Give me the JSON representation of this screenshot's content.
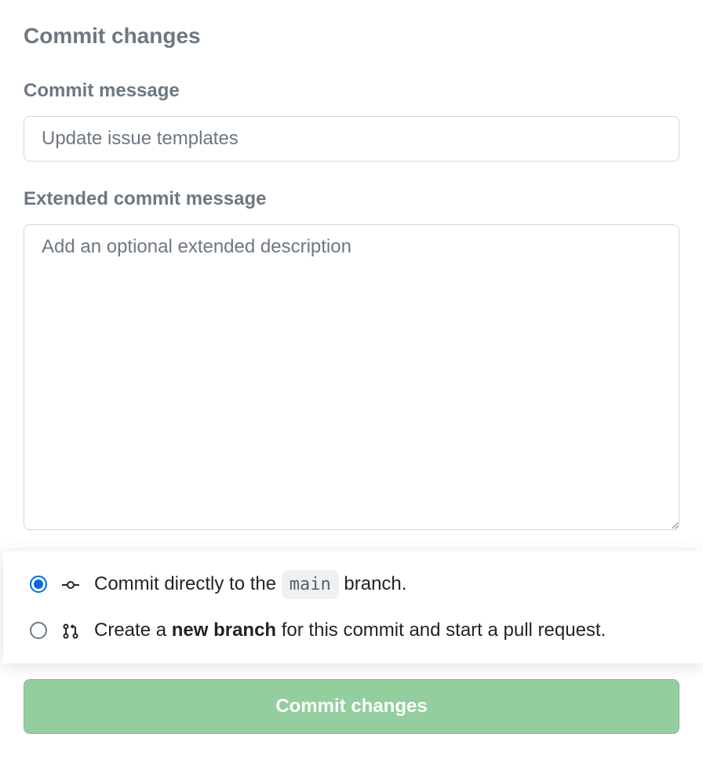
{
  "heading": "Commit changes",
  "commit_message": {
    "label": "Commit message",
    "value": "Update issue templates"
  },
  "extended_message": {
    "label": "Extended commit message",
    "placeholder": "Add an optional extended description"
  },
  "branch_options": {
    "direct": {
      "prefix": "Commit directly to the ",
      "branch": "main",
      "suffix": " branch.",
      "selected": true
    },
    "new_branch": {
      "prefix": "Create a ",
      "bold": "new branch",
      "suffix": " for this commit and start a pull request.",
      "selected": false
    }
  },
  "submit_label": "Commit changes"
}
